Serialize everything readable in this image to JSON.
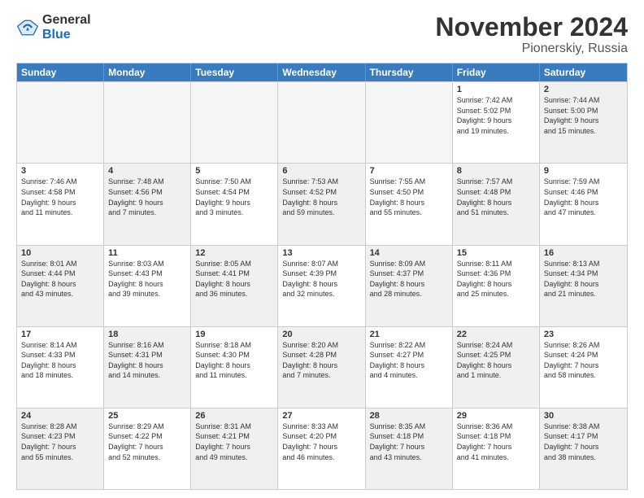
{
  "header": {
    "logo_general": "General",
    "logo_blue": "Blue",
    "month_title": "November 2024",
    "subtitle": "Pionerskiy, Russia"
  },
  "days_of_week": [
    "Sunday",
    "Monday",
    "Tuesday",
    "Wednesday",
    "Thursday",
    "Friday",
    "Saturday"
  ],
  "rows": [
    [
      {
        "day": "",
        "info": "",
        "empty": true
      },
      {
        "day": "",
        "info": "",
        "empty": true
      },
      {
        "day": "",
        "info": "",
        "empty": true
      },
      {
        "day": "",
        "info": "",
        "empty": true
      },
      {
        "day": "",
        "info": "",
        "empty": true
      },
      {
        "day": "1",
        "info": "Sunrise: 7:42 AM\nSunset: 5:02 PM\nDaylight: 9 hours\nand 19 minutes."
      },
      {
        "day": "2",
        "info": "Sunrise: 7:44 AM\nSunset: 5:00 PM\nDaylight: 9 hours\nand 15 minutes.",
        "shaded": true
      }
    ],
    [
      {
        "day": "3",
        "info": "Sunrise: 7:46 AM\nSunset: 4:58 PM\nDaylight: 9 hours\nand 11 minutes."
      },
      {
        "day": "4",
        "info": "Sunrise: 7:48 AM\nSunset: 4:56 PM\nDaylight: 9 hours\nand 7 minutes.",
        "shaded": true
      },
      {
        "day": "5",
        "info": "Sunrise: 7:50 AM\nSunset: 4:54 PM\nDaylight: 9 hours\nand 3 minutes."
      },
      {
        "day": "6",
        "info": "Sunrise: 7:53 AM\nSunset: 4:52 PM\nDaylight: 8 hours\nand 59 minutes.",
        "shaded": true
      },
      {
        "day": "7",
        "info": "Sunrise: 7:55 AM\nSunset: 4:50 PM\nDaylight: 8 hours\nand 55 minutes."
      },
      {
        "day": "8",
        "info": "Sunrise: 7:57 AM\nSunset: 4:48 PM\nDaylight: 8 hours\nand 51 minutes.",
        "shaded": true
      },
      {
        "day": "9",
        "info": "Sunrise: 7:59 AM\nSunset: 4:46 PM\nDaylight: 8 hours\nand 47 minutes."
      }
    ],
    [
      {
        "day": "10",
        "info": "Sunrise: 8:01 AM\nSunset: 4:44 PM\nDaylight: 8 hours\nand 43 minutes.",
        "shaded": true
      },
      {
        "day": "11",
        "info": "Sunrise: 8:03 AM\nSunset: 4:43 PM\nDaylight: 8 hours\nand 39 minutes."
      },
      {
        "day": "12",
        "info": "Sunrise: 8:05 AM\nSunset: 4:41 PM\nDaylight: 8 hours\nand 36 minutes.",
        "shaded": true
      },
      {
        "day": "13",
        "info": "Sunrise: 8:07 AM\nSunset: 4:39 PM\nDaylight: 8 hours\nand 32 minutes."
      },
      {
        "day": "14",
        "info": "Sunrise: 8:09 AM\nSunset: 4:37 PM\nDaylight: 8 hours\nand 28 minutes.",
        "shaded": true
      },
      {
        "day": "15",
        "info": "Sunrise: 8:11 AM\nSunset: 4:36 PM\nDaylight: 8 hours\nand 25 minutes."
      },
      {
        "day": "16",
        "info": "Sunrise: 8:13 AM\nSunset: 4:34 PM\nDaylight: 8 hours\nand 21 minutes.",
        "shaded": true
      }
    ],
    [
      {
        "day": "17",
        "info": "Sunrise: 8:14 AM\nSunset: 4:33 PM\nDaylight: 8 hours\nand 18 minutes."
      },
      {
        "day": "18",
        "info": "Sunrise: 8:16 AM\nSunset: 4:31 PM\nDaylight: 8 hours\nand 14 minutes.",
        "shaded": true
      },
      {
        "day": "19",
        "info": "Sunrise: 8:18 AM\nSunset: 4:30 PM\nDaylight: 8 hours\nand 11 minutes."
      },
      {
        "day": "20",
        "info": "Sunrise: 8:20 AM\nSunset: 4:28 PM\nDaylight: 8 hours\nand 7 minutes.",
        "shaded": true
      },
      {
        "day": "21",
        "info": "Sunrise: 8:22 AM\nSunset: 4:27 PM\nDaylight: 8 hours\nand 4 minutes."
      },
      {
        "day": "22",
        "info": "Sunrise: 8:24 AM\nSunset: 4:25 PM\nDaylight: 8 hours\nand 1 minute.",
        "shaded": true
      },
      {
        "day": "23",
        "info": "Sunrise: 8:26 AM\nSunset: 4:24 PM\nDaylight: 7 hours\nand 58 minutes."
      }
    ],
    [
      {
        "day": "24",
        "info": "Sunrise: 8:28 AM\nSunset: 4:23 PM\nDaylight: 7 hours\nand 55 minutes.",
        "shaded": true
      },
      {
        "day": "25",
        "info": "Sunrise: 8:29 AM\nSunset: 4:22 PM\nDaylight: 7 hours\nand 52 minutes."
      },
      {
        "day": "26",
        "info": "Sunrise: 8:31 AM\nSunset: 4:21 PM\nDaylight: 7 hours\nand 49 minutes.",
        "shaded": true
      },
      {
        "day": "27",
        "info": "Sunrise: 8:33 AM\nSunset: 4:20 PM\nDaylight: 7 hours\nand 46 minutes."
      },
      {
        "day": "28",
        "info": "Sunrise: 8:35 AM\nSunset: 4:18 PM\nDaylight: 7 hours\nand 43 minutes.",
        "shaded": true
      },
      {
        "day": "29",
        "info": "Sunrise: 8:36 AM\nSunset: 4:18 PM\nDaylight: 7 hours\nand 41 minutes."
      },
      {
        "day": "30",
        "info": "Sunrise: 8:38 AM\nSunset: 4:17 PM\nDaylight: 7 hours\nand 38 minutes.",
        "shaded": true
      }
    ]
  ]
}
